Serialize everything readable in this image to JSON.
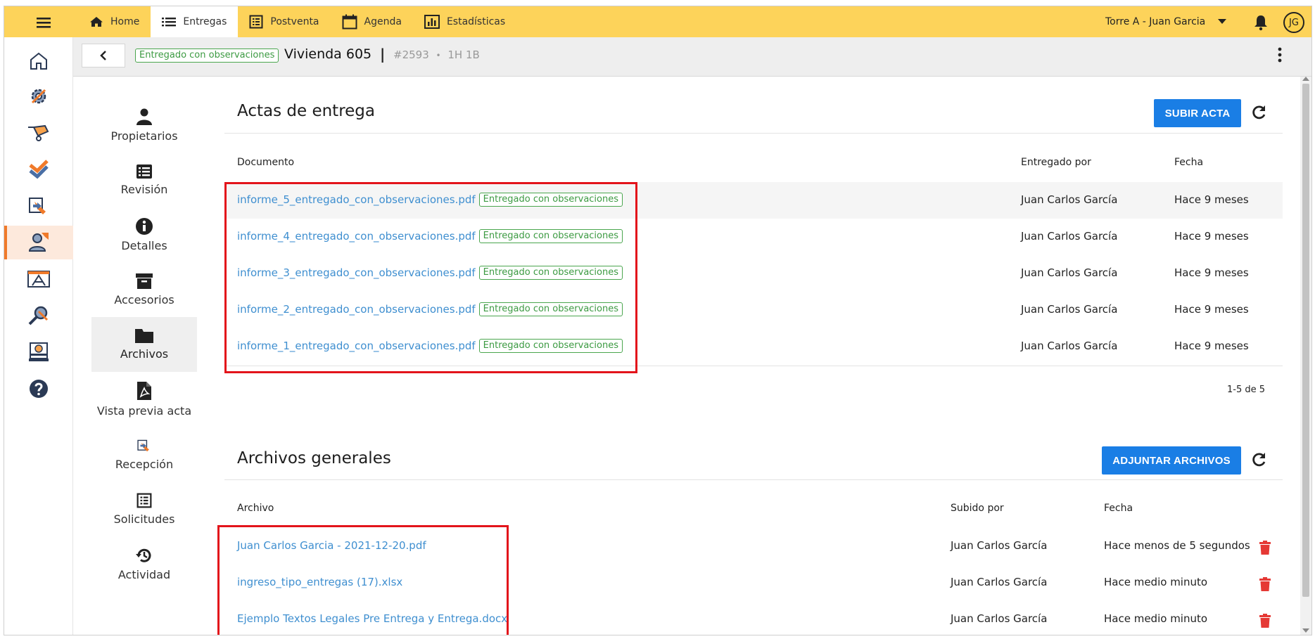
{
  "topbar": {
    "nav": [
      {
        "label": "Home",
        "icon": "home-icon"
      },
      {
        "label": "Entregas",
        "icon": "list-icon"
      },
      {
        "label": "Postventa",
        "icon": "checklist-icon"
      },
      {
        "label": "Agenda",
        "icon": "calendar-icon"
      },
      {
        "label": "Estadísticas",
        "icon": "bar-chart-icon"
      }
    ],
    "project": "Torre A - Juan Garcia",
    "avatar": "JG"
  },
  "colors": {
    "topbar": "#fdd35a",
    "primary": "#1a7ee5",
    "status_green": "#3c9a42",
    "link": "#3f8fd0",
    "highlight": "#e3141b",
    "delete": "#e53935",
    "rail_active": "#f07a2a"
  },
  "header": {
    "status": "Entregado con observaciones",
    "title": "Vivienda 605",
    "separator": "|",
    "id": "#2593",
    "dot": "•",
    "typology": "1H 1B"
  },
  "submenu": [
    {
      "label": "Propietarios",
      "icon": "person-icon"
    },
    {
      "label": "Revisión",
      "icon": "list-box-icon"
    },
    {
      "label": "Detalles",
      "icon": "info-icon"
    },
    {
      "label": "Accesorios",
      "icon": "archive-box-icon"
    },
    {
      "label": "Archivos",
      "icon": "folder-icon"
    },
    {
      "label": "Vista previa acta",
      "icon": "pdf-file-icon"
    },
    {
      "label": "Recepción",
      "icon": "reception-icon"
    },
    {
      "label": "Solicitudes",
      "icon": "checklist-icon"
    },
    {
      "label": "Actividad",
      "icon": "history-icon"
    }
  ],
  "actas": {
    "title": "Actas de entrega",
    "button": "SUBIR ACTA",
    "columns": {
      "document": "Documento",
      "delivered_by": "Entregado por",
      "date": "Fecha"
    },
    "rows": [
      {
        "file": "informe_5_entregado_con_observaciones.pdf",
        "status": "Entregado con observaciones",
        "by": "Juan Carlos García",
        "date": "Hace 9 meses"
      },
      {
        "file": "informe_4_entregado_con_observaciones.pdf",
        "status": "Entregado con observaciones",
        "by": "Juan Carlos García",
        "date": "Hace 9 meses"
      },
      {
        "file": "informe_3_entregado_con_observaciones.pdf",
        "status": "Entregado con observaciones",
        "by": "Juan Carlos García",
        "date": "Hace 9 meses"
      },
      {
        "file": "informe_2_entregado_con_observaciones.pdf",
        "status": "Entregado con observaciones",
        "by": "Juan Carlos García",
        "date": "Hace 9 meses"
      },
      {
        "file": "informe_1_entregado_con_observaciones.pdf",
        "status": "Entregado con observaciones",
        "by": "Juan Carlos García",
        "date": "Hace 9 meses"
      }
    ],
    "pagination": "1-5 de 5"
  },
  "archivos": {
    "title": "Archivos generales",
    "button": "ADJUNTAR ARCHIVOS",
    "columns": {
      "file": "Archivo",
      "uploaded_by": "Subido por",
      "date": "Fecha"
    },
    "rows": [
      {
        "file": "Juan Carlos Garcia - 2021-12-20.pdf",
        "by": "Juan Carlos García",
        "date": "Hace menos de 5 segundos"
      },
      {
        "file": "ingreso_tipo_entregas (17).xlsx",
        "by": "Juan Carlos García",
        "date": "Hace medio minuto"
      },
      {
        "file": "Ejemplo Textos Legales Pre Entrega y Entrega.docx",
        "by": "Juan Carlos García",
        "date": "Hace medio minuto"
      }
    ]
  }
}
